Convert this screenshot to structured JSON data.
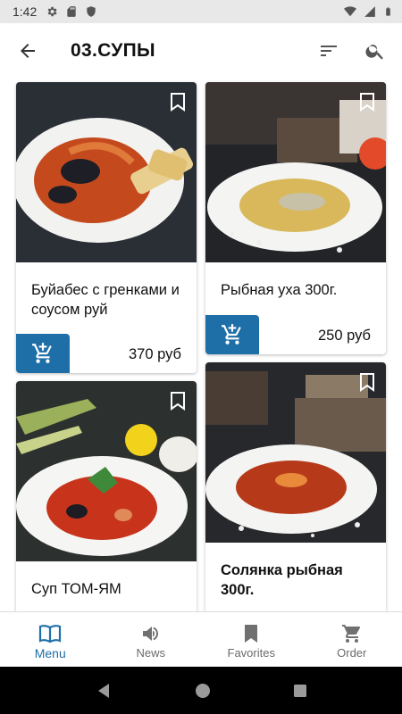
{
  "status_bar": {
    "time": "1:42"
  },
  "app_bar": {
    "title": "03.СУПЫ"
  },
  "cards": [
    {
      "title": "Буйабес с гренками и соусом руй",
      "price": "370 руб"
    },
    {
      "title": "Рыбная уха 300г.",
      "price": "250 руб"
    },
    {
      "title": "Суп ТОМ-ЯМ",
      "price": ""
    },
    {
      "title": "Солянка рыбная 300г.",
      "price": ""
    }
  ],
  "bottom_nav": [
    {
      "label": "Menu",
      "icon": "book-open-icon",
      "active": true
    },
    {
      "label": "News",
      "icon": "megaphone-icon",
      "active": false
    },
    {
      "label": "Favorites",
      "icon": "bookmark-icon",
      "active": false
    },
    {
      "label": "Order",
      "icon": "cart-icon",
      "active": false
    }
  ],
  "colors": {
    "accent": "#1e6fa8",
    "status_bar": "#e8e8e8",
    "system_nav": "#000000"
  }
}
